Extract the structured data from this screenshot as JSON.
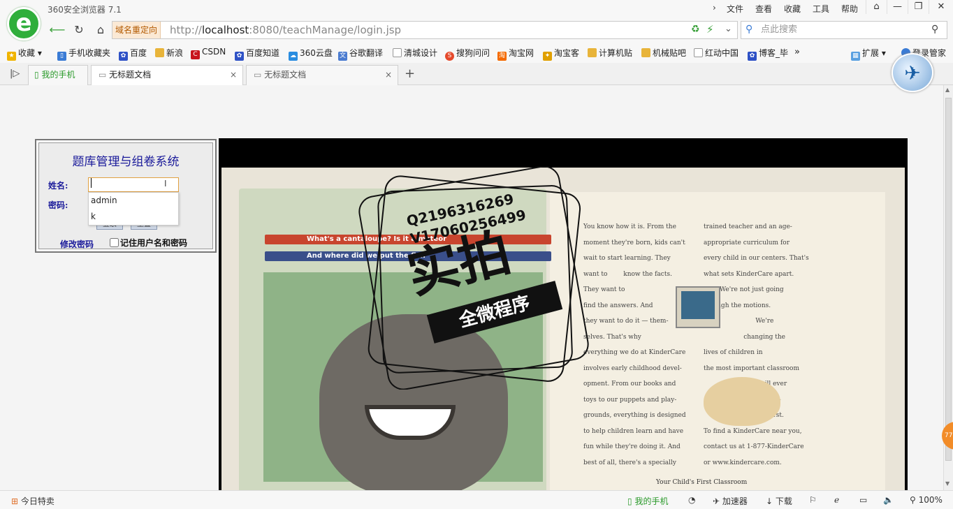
{
  "window": {
    "title": "360安全浏览器 7.1",
    "menu": [
      "文件",
      "查看",
      "收藏",
      "工具",
      "帮助"
    ]
  },
  "nav": {
    "redirect_label": "域名重定向",
    "url_prefix": "http://",
    "url_host": "localhost",
    "url_rest": ":8080/teachManage/login.jsp",
    "search_placeholder": "点此搜索"
  },
  "bookmarks": [
    {
      "label": "收藏",
      "icon": "star-icon",
      "color": "#f0b400"
    },
    {
      "label": "手机收藏夹",
      "icon": "phone-icon",
      "color": "#3a7bd5"
    },
    {
      "label": "百度",
      "icon": "baidu-paw-icon",
      "color": "#2f52c6"
    },
    {
      "label": "新浪",
      "icon": "folder-icon",
      "color": "#e8b43a"
    },
    {
      "label": "CSDN",
      "icon": "csdn-icon",
      "color": "#c8151d"
    },
    {
      "label": "百度知道",
      "icon": "baidu-paw-icon",
      "color": "#2f52c6"
    },
    {
      "label": "360云盘",
      "icon": "cloud-icon",
      "color": "#2a8de0"
    },
    {
      "label": "谷歌翻译",
      "icon": "translate-icon",
      "color": "#4a7bd0"
    },
    {
      "label": "清城设计",
      "icon": "page-icon",
      "color": "#9a9a9a"
    },
    {
      "label": "搜狗问问",
      "icon": "sogou-icon",
      "color": "#e5492b"
    },
    {
      "label": "淘宝网",
      "icon": "taobao-icon",
      "color": "#f56a00"
    },
    {
      "label": "淘宝客",
      "icon": "bird-icon",
      "color": "#e0a000"
    },
    {
      "label": "计算机贴",
      "icon": "folder-icon",
      "color": "#e8b43a"
    },
    {
      "label": "机械贴吧",
      "icon": "folder-icon",
      "color": "#e8b43a"
    },
    {
      "label": "红动中国",
      "icon": "page-icon",
      "color": "#9a9a9a"
    },
    {
      "label": "博客_毕",
      "icon": "baidu-paw-icon",
      "color": "#2f52c6"
    }
  ],
  "bookmarks_right": {
    "extensions": "扩展",
    "login": "登录管家"
  },
  "tabs": [
    {
      "label": "我的手机",
      "active": false
    },
    {
      "label": "无标题文档",
      "active": true
    },
    {
      "label": "无标题文档",
      "active": false
    }
  ],
  "login": {
    "title": "题库管理与组卷系统",
    "name_label": "姓名:",
    "password_label": "密码:",
    "name_value": "",
    "autocomplete": [
      "admin",
      "k"
    ],
    "login_button": "登录",
    "reset_button": "重置",
    "change_password": "修改密码",
    "remember_label": "记住用户名和密码"
  },
  "photo": {
    "watermark_q": "Q2196316269",
    "watermark_v": "V17060256499",
    "watermark_big": "实拍",
    "watermark_ribbon": "全微程序",
    "pencil_1": "What's a cantaloupe? Is it a meteor",
    "pencil_2": "And where did we put the fish",
    "footer_text": "Your Child's First Classroom"
  },
  "statusbar": {
    "left": "今日特卖",
    "my_phone": "我的手机",
    "accelerator": "加速器",
    "download": "下载",
    "zoom": "100%"
  }
}
